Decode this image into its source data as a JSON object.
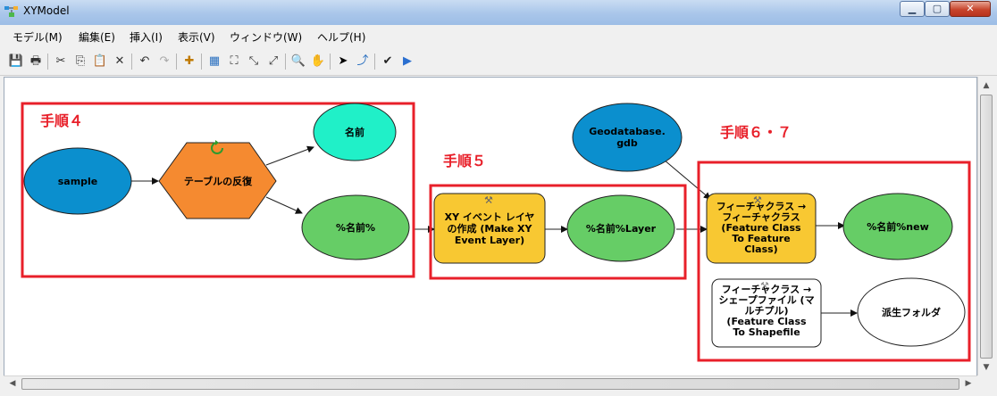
{
  "window": {
    "title": "XYModel"
  },
  "menu": [
    {
      "label": "モデル(M)"
    },
    {
      "label": "編集(E)"
    },
    {
      "label": "挿入(I)"
    },
    {
      "label": "表示(V)"
    },
    {
      "label": "ウィンドウ(W)"
    },
    {
      "label": "ヘルプ(H)"
    }
  ],
  "toolbar": [
    {
      "name": "save-icon",
      "glyph": "💾"
    },
    {
      "name": "print-icon",
      "glyph": "🖶"
    },
    {
      "name": "cut-icon",
      "glyph": "✂"
    },
    {
      "name": "copy-icon",
      "glyph": "⎘"
    },
    {
      "name": "paste-icon",
      "glyph": "📋"
    },
    {
      "name": "delete-icon",
      "glyph": "✕"
    },
    {
      "name": "undo-icon",
      "glyph": "↶"
    },
    {
      "name": "redo-icon",
      "glyph": "↷"
    },
    {
      "name": "add-data-icon",
      "glyph": "✚"
    },
    {
      "name": "auto-layout-icon",
      "glyph": "▦"
    },
    {
      "name": "full-extent-icon",
      "glyph": "⛶"
    },
    {
      "name": "fixed-zoom-in-icon",
      "glyph": "⤡"
    },
    {
      "name": "fixed-zoom-out-icon",
      "glyph": "⤢"
    },
    {
      "name": "zoom-in-icon",
      "glyph": "🔍"
    },
    {
      "name": "pan-icon",
      "glyph": "✋"
    },
    {
      "name": "select-icon",
      "glyph": "➤"
    },
    {
      "name": "connect-icon",
      "glyph": "⤴"
    },
    {
      "name": "validate-icon",
      "glyph": "✔"
    },
    {
      "name": "run-icon",
      "glyph": "▶"
    }
  ],
  "colors": {
    "blue_node": "#0b8fce",
    "green_node": "#66cd66",
    "cyan_node": "#20f0c8",
    "orange_node": "#f58a30",
    "yellow_node": "#f8c832",
    "step_red": "#e8202a",
    "box_red": "#e8202a"
  },
  "steps": {
    "step4": "手順４",
    "step5": "手順５",
    "step67": "手順６・７"
  },
  "nodes": {
    "sample": "sample",
    "iterator": "テーブルの反復",
    "name": "名前",
    "name_var": "%名前%",
    "xy_tool": [
      "XY イベント レイヤ",
      "の作成 (Make XY",
      "Event Layer)"
    ],
    "name_layer": "%名前%Layer",
    "gdb": [
      "Geodatabase.",
      "gdb"
    ],
    "fc2fc": [
      "フィーチャクラス →",
      "フィーチャクラス",
      "(Feature Class",
      "To Feature",
      "Class)"
    ],
    "name_new": "%名前%new",
    "fc2shp": [
      "フィーチャクラス →",
      "シェープファイル (マ",
      "ルチプル)",
      "(Feature Class",
      "To Shapefile"
    ],
    "out_folder": "派生フォルダ"
  }
}
